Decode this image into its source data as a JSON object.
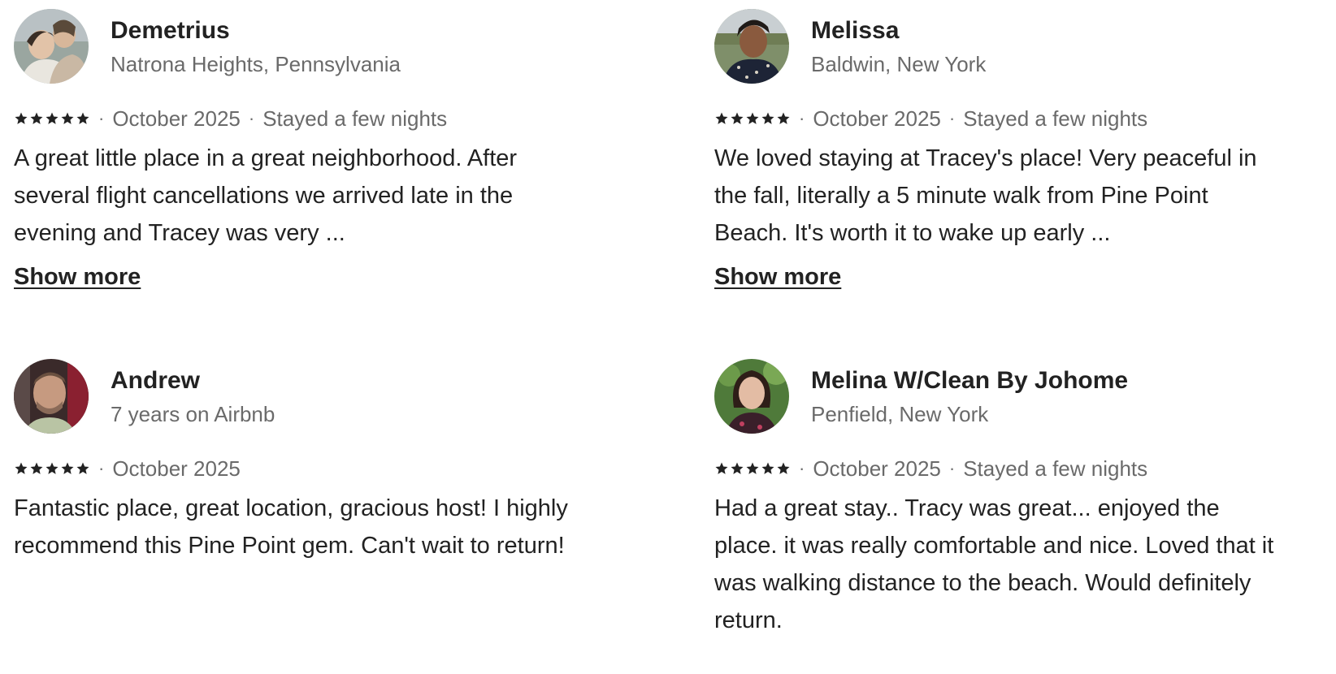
{
  "reviews": [
    {
      "name": "Demetrius",
      "subtitle": "Natrona Heights, Pennsylvania",
      "rating": 5,
      "date": "October 2025",
      "stay": "Stayed a few nights",
      "text": "A great little place in a great neighborhood. After several flight cancellations we arrived late in the evening and Tracey was very ...",
      "show_more": "Show more"
    },
    {
      "name": "Melissa",
      "subtitle": "Baldwin, New York",
      "rating": 5,
      "date": "October 2025",
      "stay": "Stayed a few nights",
      "text": "We loved staying at Tracey's place! Very peaceful in the fall, literally a 5 minute walk from Pine Point Beach. It's worth it to wake up early ...",
      "show_more": "Show more"
    },
    {
      "name": "Andrew",
      "subtitle": "7 years on Airbnb",
      "rating": 5,
      "date": "October 2025",
      "text": "Fantastic place, great location, gracious host! I highly recommend this Pine Point gem. Can't wait to return!"
    },
    {
      "name": "Melina W/Clean By Johome",
      "subtitle": "Penfield, New York",
      "rating": 5,
      "date": "October 2025",
      "stay": "Stayed a few nights",
      "text": "Had a great stay.. Tracy was great... enjoyed the place. it was really comfortable and nice. Loved that it was walking distance to the beach. Would definitely return."
    }
  ],
  "separator": "·",
  "icons": {
    "star": "star-icon"
  },
  "colors": {
    "primary_text": "#222222",
    "secondary_text": "#6a6a6a"
  }
}
